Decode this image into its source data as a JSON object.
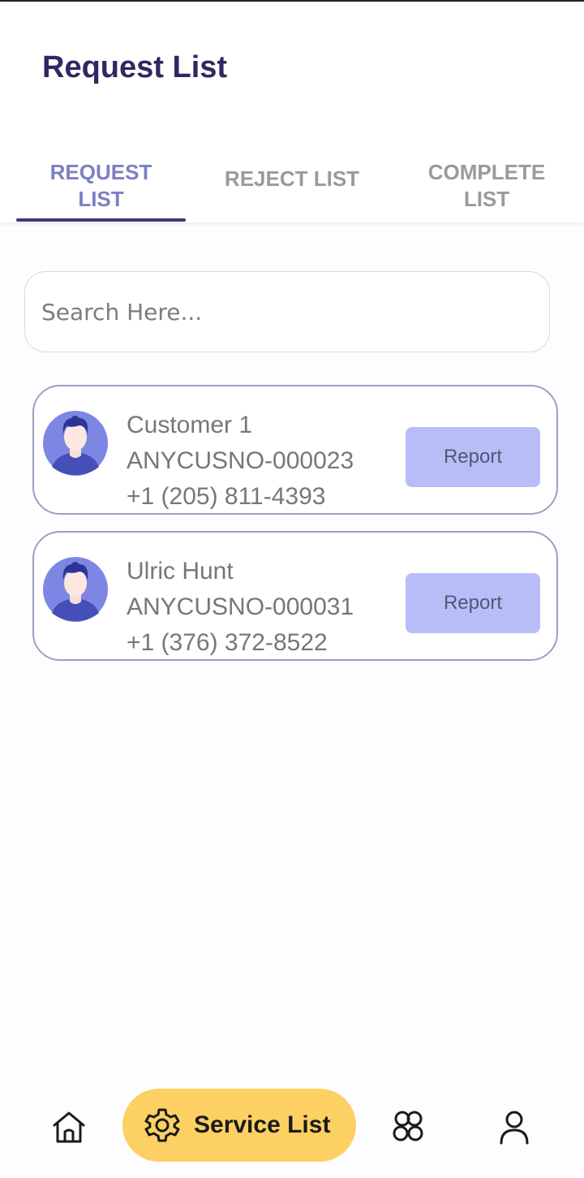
{
  "header": {
    "title": "Request List"
  },
  "tabs": [
    {
      "label": "REQUEST\nLIST",
      "line1": "REQUEST",
      "line2": "LIST",
      "active": true
    },
    {
      "label": "REJECT LIST",
      "line1": "REJECT LIST",
      "line2": "",
      "active": false
    },
    {
      "label": "COMPLETE\nLIST",
      "line1": "COMPLETE",
      "line2": "LIST",
      "active": false
    }
  ],
  "search": {
    "placeholder": "Search Here...",
    "value": ""
  },
  "requests": [
    {
      "name": "Customer 1",
      "customer_no": "ANYCUSNO-000023",
      "phone": "+1 (205) 811-4393",
      "action_label": "Report",
      "avatar_icon": "user-avatar-icon"
    },
    {
      "name": "Ulric Hunt",
      "customer_no": "ANYCUSNO-000031",
      "phone": "+1 (376) 372-8522",
      "action_label": "Report",
      "avatar_icon": "user-avatar-icon"
    }
  ],
  "bottom_nav": {
    "items": [
      {
        "icon": "home-icon",
        "label": ""
      },
      {
        "icon": "gear-icon",
        "label": "Service List",
        "active": true
      },
      {
        "icon": "groups-icon",
        "label": ""
      },
      {
        "icon": "profile-icon",
        "label": ""
      }
    ]
  },
  "colors": {
    "title": "#2f2862",
    "active_tab": "#7b80c4",
    "tab_indicator": "#3d3a78",
    "card_border": "#a09ec0",
    "report_button": "#b8bdf8",
    "nav_active_pill": "#fdd063"
  }
}
